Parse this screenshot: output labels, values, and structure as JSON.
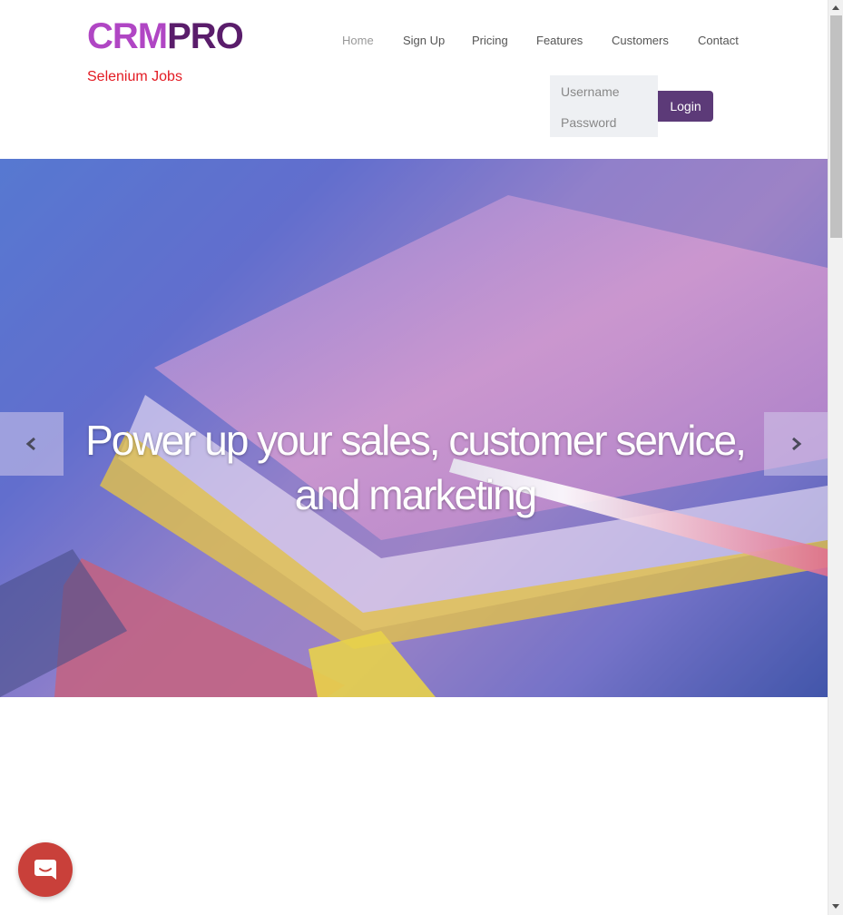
{
  "header": {
    "logo_part1": "CRM",
    "logo_part2": "PRO",
    "subtitle": "Selenium Jobs"
  },
  "nav": {
    "items": [
      {
        "label": "Home",
        "active": true
      },
      {
        "label": "Sign Up"
      },
      {
        "label": "Pricing"
      },
      {
        "label": "Features"
      },
      {
        "label": "Customers"
      },
      {
        "label": "Contact"
      }
    ]
  },
  "login": {
    "username_placeholder": "Username",
    "password_placeholder": "Password",
    "button_label": "Login"
  },
  "hero": {
    "caption": "Power up your sales, customer service, and marketing",
    "prev_icon": "chevron-left-icon",
    "next_icon": "chevron-right-icon"
  },
  "colors": {
    "logo_light": "#b046c4",
    "logo_dark": "#5a1d6b",
    "subtitle": "#e31b23",
    "login_button": "#5c3a78",
    "chat_button": "#c9403a"
  },
  "chat": {
    "icon": "chat-icon"
  }
}
